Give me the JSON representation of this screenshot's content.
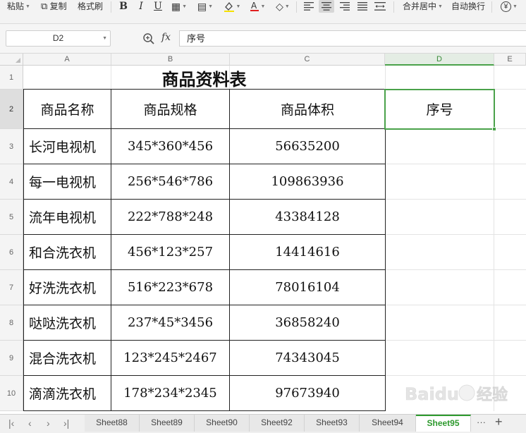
{
  "toolbar": {
    "paste_label": "粘贴",
    "copy_label": "复制",
    "format_painter_label": "格式刷",
    "merge_center_label": "合并居中",
    "wrap_text_label": "自动换行"
  },
  "formula_bar": {
    "cell_ref": "D2",
    "fx_label": "fx",
    "formula": "序号"
  },
  "columns": [
    "A",
    "B",
    "C",
    "D",
    "E"
  ],
  "rows": [
    "1",
    "2",
    "3",
    "4",
    "5",
    "6",
    "7",
    "8",
    "9",
    "10"
  ],
  "sheet": {
    "title": "商品资料表",
    "headers": [
      "商品名称",
      "商品规格",
      "商品体积",
      "序号"
    ],
    "data": [
      {
        "name": "长河电视机",
        "spec": "345*360*456",
        "volume": "56635200"
      },
      {
        "name": "每一电视机",
        "spec": "256*546*786",
        "volume": "109863936"
      },
      {
        "name": "流年电视机",
        "spec": "222*788*248",
        "volume": "43384128"
      },
      {
        "name": "和合洗衣机",
        "spec": "456*123*257",
        "volume": "14414616"
      },
      {
        "name": "好洗洗衣机",
        "spec": "516*223*678",
        "volume": "78016104"
      },
      {
        "name": "哒哒洗衣机",
        "spec": "237*45*3456",
        "volume": "36858240"
      },
      {
        "name": "混合洗衣机",
        "spec": "123*245*2467",
        "volume": "74343045"
      },
      {
        "name": "滴滴洗衣机",
        "spec": "178*234*2345",
        "volume": "97673940"
      }
    ]
  },
  "tabs": [
    "Sheet88",
    "Sheet89",
    "Sheet90",
    "Sheet92",
    "Sheet93",
    "Sheet94",
    "Sheet95"
  ],
  "active_tab": "Sheet95",
  "tab_more": "···",
  "tab_add": "+",
  "watermark_text": "Baidu经验",
  "colors": {
    "selection_green": "#4aa24a",
    "active_tab_green": "#2e9a2e"
  }
}
